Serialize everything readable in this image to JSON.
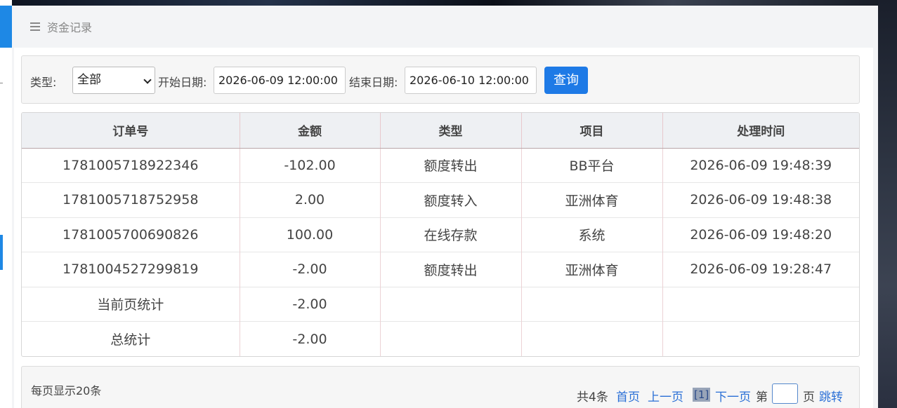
{
  "header": {
    "title": "资金记录"
  },
  "filter": {
    "type_label": "类型:",
    "type_value": "全部",
    "start_label": "开始日期:",
    "start_value": "2026-06-09 12:00:00",
    "end_label": "结束日期:",
    "end_value": "2026-06-10 12:00:00",
    "query_label": "查询"
  },
  "table": {
    "columns": [
      "订单号",
      "金额",
      "类型",
      "项目",
      "处理时间"
    ],
    "rows": [
      [
        "1781005718922346",
        "-102.00",
        "额度转出",
        "BB平台",
        "2026-06-09 19:48:39"
      ],
      [
        "1781005718752958",
        "2.00",
        "额度转入",
        "亚洲体育",
        "2026-06-09 19:48:38"
      ],
      [
        "1781005700690826",
        "100.00",
        "在线存款",
        "系统",
        "2026-06-09 19:48:20"
      ],
      [
        "1781004527299819",
        "-2.00",
        "额度转出",
        "亚洲体育",
        "2026-06-09 19:28:47"
      ],
      [
        "当前页统计",
        "-2.00",
        "",
        "",
        ""
      ],
      [
        "总统计",
        "-2.00",
        "",
        "",
        ""
      ]
    ]
  },
  "pager": {
    "per_page": "每页显示20条",
    "total": "共4条",
    "first": "首页",
    "prev": "上一页",
    "current": "[1]",
    "next": "下一页",
    "page_prefix": "第",
    "page_suffix": "页",
    "jump": "跳转"
  }
}
